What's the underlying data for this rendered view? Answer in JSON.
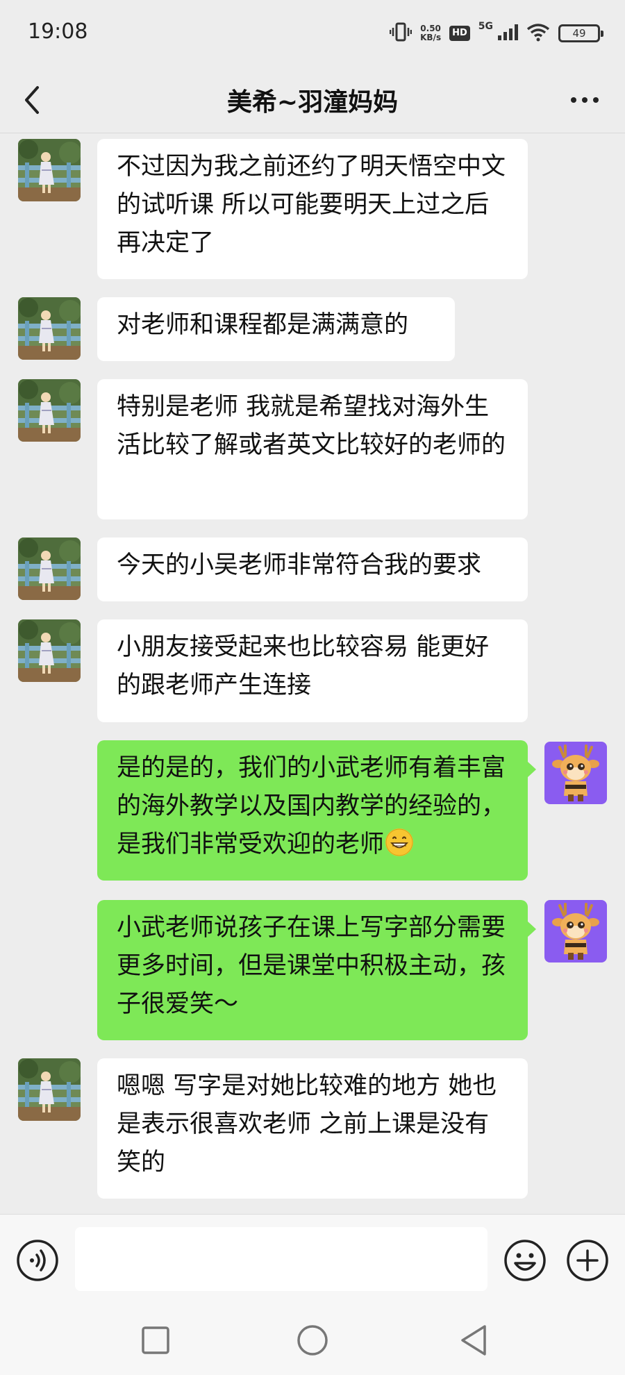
{
  "status_bar": {
    "time": "19:08",
    "net_speed_value": "0.50",
    "net_speed_unit": "KB/s",
    "hd": "HD",
    "network": "5G",
    "battery": "49"
  },
  "header": {
    "title": "美希~羽潼妈妈"
  },
  "messages": [
    {
      "side": "in",
      "text": "不过因为我之前还约了明天悟空中文的试听课 所以可能要明天上过之后再决定了"
    },
    {
      "side": "in",
      "text": "对老师和课程都是满满意的"
    },
    {
      "side": "in",
      "text": "特别是老师 我就是希望找对海外生活比较了解或者英文比较好的老师的"
    },
    {
      "side": "in",
      "text": "今天的小吴老师非常符合我的要求"
    },
    {
      "side": "in",
      "text": "小朋友接受起来也比较容易 能更好的跟老师产生连接"
    },
    {
      "side": "out",
      "text": "是的是的，我们的小武老师有着丰富的海外教学以及国内教学的经验的，是我们非常受欢迎的老师",
      "emoji": "grinning-face"
    },
    {
      "side": "out",
      "text": "小武老师说孩子在课上写字部分需要更多时间，但是课堂中积极主动，孩子很爱笑～"
    },
    {
      "side": "in",
      "text": "嗯嗯 写字是对她比较难的地方 她也是表示很喜欢老师 之前上课是没有笑的"
    }
  ],
  "input_bar": {
    "voice_icon": "voice-icon",
    "emoji_icon": "emoji-icon",
    "plus_icon": "plus-icon",
    "input_value": ""
  },
  "nav_bar": {
    "recent_icon": "square-icon",
    "home_icon": "circle-icon",
    "back_icon": "triangle-back-icon"
  },
  "colors": {
    "background": "#ededed",
    "bubble_in": "#ffffff",
    "bubble_out": "#7ee857",
    "deer_avatar_bg": "#8a5cf0"
  }
}
